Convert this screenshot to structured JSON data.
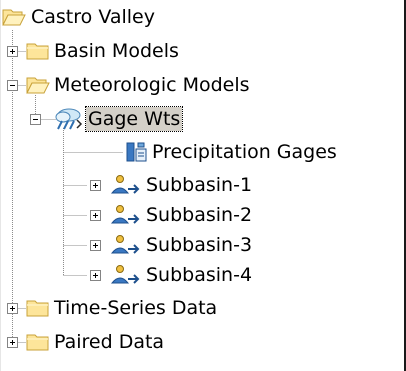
{
  "tree": {
    "root": {
      "label": "Castro Valley",
      "icon": "folder-open-icon"
    },
    "basin_models": {
      "label": "Basin Models",
      "icon": "folder-icon",
      "expander": "collapsed"
    },
    "meteorologic_models": {
      "label": "Meteorologic Models",
      "icon": "folder-open-icon",
      "expander": "expanded"
    },
    "gage_wts": {
      "label": "Gage Wts",
      "icon": "weather-model-icon",
      "expander": "expanded",
      "selected": true
    },
    "precipitation_gages": {
      "label": "Precipitation Gages",
      "icon": "precipitation-gages-icon"
    },
    "subbasins": [
      {
        "label": "Subbasin-1",
        "icon": "subbasin-icon",
        "expander": "collapsed"
      },
      {
        "label": "Subbasin-2",
        "icon": "subbasin-icon",
        "expander": "collapsed"
      },
      {
        "label": "Subbasin-3",
        "icon": "subbasin-icon",
        "expander": "collapsed"
      },
      {
        "label": "Subbasin-4",
        "icon": "subbasin-icon",
        "expander": "collapsed"
      }
    ],
    "time_series_data": {
      "label": "Time-Series Data",
      "icon": "folder-icon",
      "expander": "collapsed"
    },
    "paired_data": {
      "label": "Paired Data",
      "icon": "folder-icon",
      "expander": "collapsed"
    }
  },
  "colors": {
    "folder_fill": "#fde59a",
    "folder_edge": "#c8a23a",
    "selection_bg": "#d4d0c8",
    "tree_lines": "#8c8c8c"
  }
}
